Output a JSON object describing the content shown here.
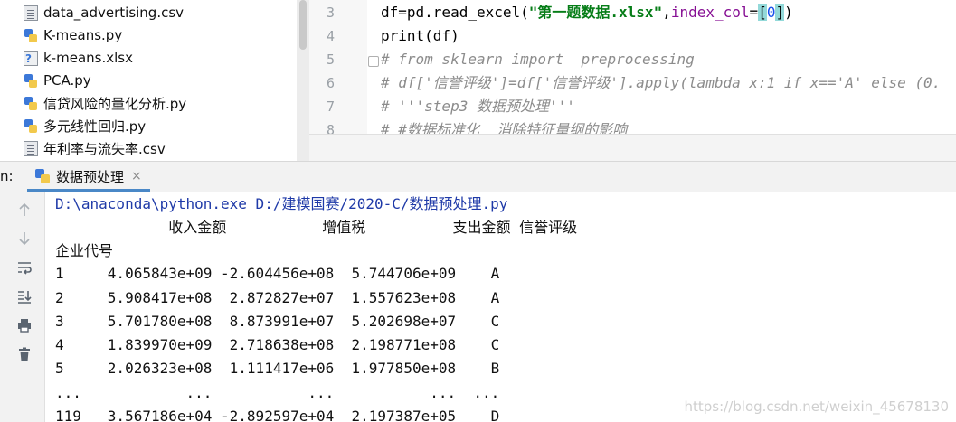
{
  "project_tree": {
    "files": [
      {
        "name": "data_advertising.csv",
        "type": "csv"
      },
      {
        "name": "K-means.py",
        "type": "py"
      },
      {
        "name": "k-means.xlsx",
        "type": "xlsx"
      },
      {
        "name": "PCA.py",
        "type": "py"
      },
      {
        "name": "信贷风险的量化分析.py",
        "type": "py"
      },
      {
        "name": "多元线性回归.py",
        "type": "py"
      },
      {
        "name": "年利率与流失率.csv",
        "type": "csv"
      }
    ]
  },
  "editor": {
    "lines": [
      {
        "num": "3",
        "text": "df=pd.read_excel(\"第一题数据.xlsx\",index_col=[0])"
      },
      {
        "num": "4",
        "text": "print(df)"
      },
      {
        "num": "5",
        "text": "# from sklearn import  preprocessing"
      },
      {
        "num": "6",
        "text": "# df['信誉评级']=df['信誉评级'].apply(lambda x:1 if x=='A' else (0."
      },
      {
        "num": "7",
        "text": "# '''step3 数据预处理'''"
      },
      {
        "num": "8",
        "text": "# #数据标准化  消除特征量纲的影响"
      }
    ]
  },
  "run_panel": {
    "label": "n:",
    "tab_title": "数据预处理",
    "close_glyph": "×",
    "toolbar_icons": [
      "up-arrow-icon",
      "down-arrow-icon",
      "soft-wrap-icon",
      "scroll-to-end-icon",
      "print-icon",
      "trash-icon"
    ]
  },
  "console": {
    "command": "D:\\anaconda\\python.exe D:/建模国赛/2020-C/数据预处理.py",
    "header": "             收入金额           增值税          支出金额 信誉评级",
    "index_name": "企业代号",
    "rows": [
      "1     4.065843e+09 -2.604456e+08  5.744706e+09    A",
      "2     5.908417e+08  2.872827e+07  1.557623e+08    A",
      "3     5.701780e+08  8.873991e+07  5.202698e+07    C",
      "4     1.839970e+09  2.718638e+08  2.198771e+08    C",
      "5     2.026323e+08  1.111417e+06  1.977850e+08    B",
      "...            ...           ...           ...  ...",
      "119   3.567186e+04 -2.892597e+04  2.197387e+05    D"
    ]
  },
  "watermark": "https://blog.csdn.net/weixin_45678130"
}
